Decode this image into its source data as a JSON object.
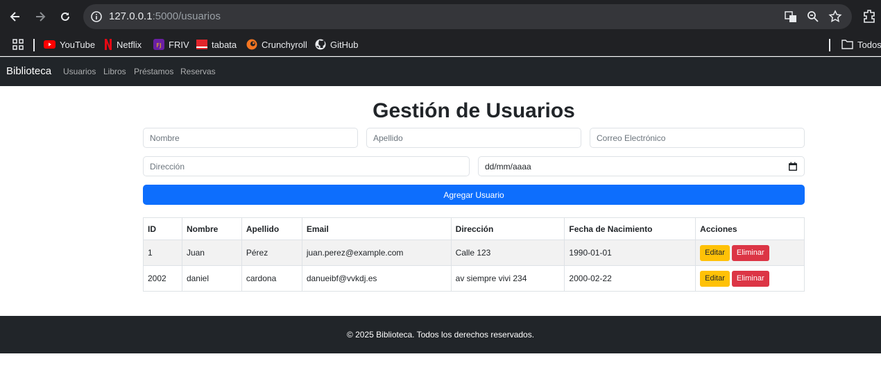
{
  "browser": {
    "url_host": "127.0.0.1",
    "url_rest": ":5000/usuarios",
    "bookmarks": [
      {
        "label": "YouTube",
        "icon": "youtube-icon"
      },
      {
        "label": "Netflix",
        "icon": "netflix-icon"
      },
      {
        "label": "FRIV",
        "icon": "friv-icon"
      },
      {
        "label": "tabata",
        "icon": "tabata-icon"
      },
      {
        "label": "Crunchyroll",
        "icon": "crunchyroll-icon"
      },
      {
        "label": "GitHub",
        "icon": "github-icon"
      }
    ],
    "all_bookmarks_label": "Todos"
  },
  "navbar": {
    "brand": "Biblioteca",
    "links": [
      "Usuarios",
      "Libros",
      "Préstamos",
      "Reservas"
    ]
  },
  "page": {
    "title": "Gestión de Usuarios"
  },
  "form": {
    "nombre_placeholder": "Nombre",
    "apellido_placeholder": "Apellido",
    "correo_placeholder": "Correo Electrónico",
    "direccion_placeholder": "Dirección",
    "fecha_placeholder": "dd/mm/aaaa",
    "submit_label": "Agregar Usuario"
  },
  "table": {
    "headers": [
      "ID",
      "Nombre",
      "Apellido",
      "Email",
      "Dirección",
      "Fecha de Nacimiento",
      "Acciones"
    ],
    "rows": [
      [
        "1",
        "Juan",
        "Pérez",
        "juan.perez@example.com",
        "Calle 123",
        "1990-01-01"
      ],
      [
        "2002",
        "daniel",
        "cardona",
        "danueibf@vvkdj.es",
        "av siempre vivi 234",
        "2000-02-22"
      ]
    ],
    "edit_label": "Editar",
    "delete_label": "Eliminar"
  },
  "footer": {
    "text": "© 2025 Biblioteca. Todos los derechos reservados."
  },
  "colors": {
    "primary": "#0d6efd",
    "warning": "#ffc107",
    "danger": "#dc3545",
    "dark": "#212529"
  }
}
